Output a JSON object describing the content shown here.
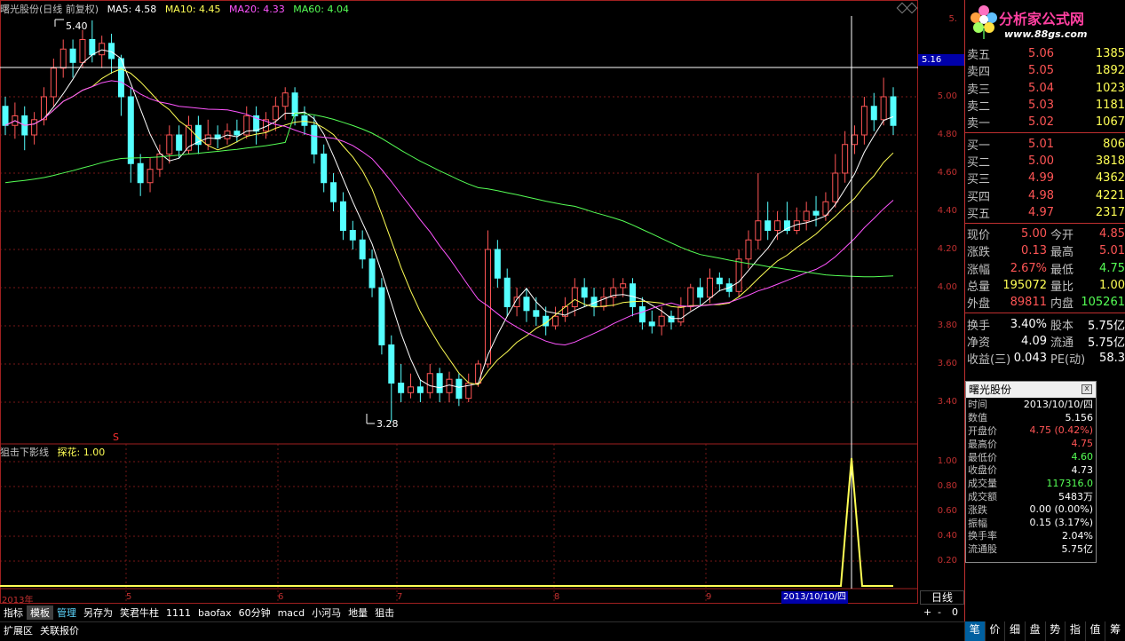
{
  "title": {
    "stock": "曙光股份(日线 前复权)",
    "ma5": "MA5: 4.58",
    "ma10": "MA10: 4.45",
    "ma20": "MA20: 4.33",
    "ma60": "MA60: 4.04"
  },
  "sub_indicator": {
    "name": "狙击下影线",
    "value": "探花: 1.00"
  },
  "price_axis": [
    "5.",
    "5.00",
    "4.80",
    "4.60",
    "4.40",
    "4.20",
    "4.00",
    "3.80",
    "3.60",
    "3.40"
  ],
  "cursor_price": "5.16",
  "sub_axis": [
    "1.00",
    "0.80",
    "0.60",
    "0.40",
    "0.20"
  ],
  "annotations": {
    "high": "5.40",
    "low": "3.28",
    "marker": "S"
  },
  "x_axis": [
    "2013年",
    "5",
    "6",
    "7",
    "8",
    "9"
  ],
  "x_cursor": "2013/10/10/四",
  "period": "日线",
  "zoom": {
    "plus": "+",
    "minus": "-",
    "zero": "0"
  },
  "toolbar1": [
    "指标",
    "模板",
    "管理",
    "另存为",
    "笑君牛柱",
    "1111",
    "baofax",
    "60分钟",
    "macd",
    "小河马",
    "地量",
    "狙击"
  ],
  "toolbar2": [
    "扩展区",
    "关联报价"
  ],
  "logo": {
    "text": "分析家公式网",
    "url": "www.88gs.com"
  },
  "order_book": {
    "asks": [
      {
        "label": "卖五",
        "price": "5.06",
        "vol": "1385"
      },
      {
        "label": "卖四",
        "price": "5.05",
        "vol": "1892"
      },
      {
        "label": "卖三",
        "price": "5.04",
        "vol": "1023"
      },
      {
        "label": "卖二",
        "price": "5.03",
        "vol": "1181"
      },
      {
        "label": "卖一",
        "price": "5.02",
        "vol": "1067"
      }
    ],
    "bids": [
      {
        "label": "买一",
        "price": "5.01",
        "vol": "806"
      },
      {
        "label": "买二",
        "price": "5.00",
        "vol": "3818"
      },
      {
        "label": "买三",
        "price": "4.99",
        "vol": "4362"
      },
      {
        "label": "买四",
        "price": "4.98",
        "vol": "4221"
      },
      {
        "label": "买五",
        "price": "4.97",
        "vol": "2317"
      }
    ]
  },
  "stats": [
    {
      "l1": "现价",
      "v1": "5.00",
      "c1": "up",
      "l2": "今开",
      "v2": "4.85",
      "c2": "up"
    },
    {
      "l1": "涨跌",
      "v1": "0.13",
      "c1": "up",
      "l2": "最高",
      "v2": "5.01",
      "c2": "up"
    },
    {
      "l1": "涨幅",
      "v1": "2.67%",
      "c1": "up",
      "l2": "最低",
      "v2": "4.75",
      "c2": "down"
    },
    {
      "l1": "总量",
      "v1": "195072",
      "c1": "yellow",
      "l2": "量比",
      "v2": "1.00",
      "c2": "yellow"
    },
    {
      "l1": "外盘",
      "v1": "89811",
      "c1": "up",
      "l2": "内盘",
      "v2": "105261",
      "c2": "down"
    }
  ],
  "stats2": [
    {
      "l1": "换手",
      "v1": "3.40%",
      "c1": "white",
      "l2": "股本",
      "v2": "5.75亿",
      "c2": "white"
    },
    {
      "l1": "净资",
      "v1": "4.09",
      "c1": "white",
      "l2": "流通",
      "v2": "5.75亿",
      "c2": "white"
    },
    {
      "l1": "收益(三)",
      "v1": "0.043",
      "c1": "white",
      "l2": "PE(动)",
      "v2": "58.3",
      "c2": "white"
    }
  ],
  "bottom_tabs": [
    "笔",
    "价",
    "细",
    "盘",
    "势",
    "指",
    "值",
    "筹"
  ],
  "info_popup": {
    "title": "曙光股份",
    "close": "x",
    "rows": [
      {
        "k": "时间",
        "v": "2013/10/10/四",
        "c": "white"
      },
      {
        "k": "数值",
        "v": "5.156",
        "c": "white"
      },
      {
        "k": "开盘价",
        "v": "4.75 (0.42%)",
        "c": "up"
      },
      {
        "k": "最高价",
        "v": "4.75",
        "c": "up"
      },
      {
        "k": "最低价",
        "v": "4.60",
        "c": "down"
      },
      {
        "k": "收盘价",
        "v": "4.73",
        "c": "white"
      },
      {
        "k": "成交量",
        "v": "117316.0",
        "c": "down"
      },
      {
        "k": "成交额",
        "v": "5483万",
        "c": "white"
      },
      {
        "k": "涨跌",
        "v": "0.00 (0.00%)",
        "c": "white"
      },
      {
        "k": "振幅",
        "v": "0.15 (3.17%)",
        "c": "white"
      },
      {
        "k": "换手率",
        "v": "2.04%",
        "c": "white"
      },
      {
        "k": "流通股",
        "v": "5.75亿",
        "c": "white"
      }
    ]
  },
  "colors": {
    "up": "#ff5555",
    "down": "#55ffff",
    "ma5": "#ffffff",
    "ma10": "#ffff55",
    "ma20": "#ff55ff",
    "ma60": "#55ff55",
    "grid": "#a02020",
    "signal": "#ffff55"
  },
  "chart_data": {
    "type": "candlestick",
    "ylim": [
      3.3,
      5.2
    ],
    "candles": [
      [
        4.95,
        4.85,
        5.0,
        4.8
      ],
      [
        4.85,
        4.9,
        4.97,
        4.78
      ],
      [
        4.9,
        4.8,
        4.95,
        4.72
      ],
      [
        4.8,
        4.88,
        4.92,
        4.75
      ],
      [
        4.88,
        5.0,
        5.05,
        4.85
      ],
      [
        5.0,
        5.15,
        5.2,
        4.95
      ],
      [
        5.15,
        5.25,
        5.3,
        5.1
      ],
      [
        5.25,
        5.18,
        5.3,
        5.1
      ],
      [
        5.18,
        5.3,
        5.35,
        5.15
      ],
      [
        5.3,
        5.22,
        5.4,
        5.18
      ],
      [
        5.22,
        5.28,
        5.32,
        5.15
      ],
      [
        5.28,
        5.2,
        5.33,
        5.12
      ],
      [
        5.2,
        5.0,
        5.22,
        4.9
      ],
      [
        5.0,
        4.65,
        5.05,
        4.55
      ],
      [
        4.65,
        4.55,
        4.7,
        4.48
      ],
      [
        4.55,
        4.62,
        4.68,
        4.5
      ],
      [
        4.62,
        4.7,
        4.75,
        4.58
      ],
      [
        4.7,
        4.8,
        4.85,
        4.65
      ],
      [
        4.8,
        4.72,
        4.85,
        4.68
      ],
      [
        4.72,
        4.85,
        4.9,
        4.7
      ],
      [
        4.85,
        4.75,
        4.9,
        4.7
      ],
      [
        4.75,
        4.8,
        4.88,
        4.72
      ],
      [
        4.8,
        4.78,
        4.85,
        4.73
      ],
      [
        4.78,
        4.82,
        4.86,
        4.75
      ],
      [
        4.82,
        4.8,
        4.88,
        4.76
      ],
      [
        4.8,
        4.9,
        4.95,
        4.78
      ],
      [
        4.9,
        4.82,
        4.95,
        4.75
      ],
      [
        4.82,
        4.88,
        4.92,
        4.78
      ],
      [
        4.88,
        4.95,
        5.0,
        4.82
      ],
      [
        4.95,
        5.02,
        5.05,
        4.88
      ],
      [
        5.02,
        4.9,
        5.05,
        4.85
      ],
      [
        4.9,
        4.85,
        4.95,
        4.8
      ],
      [
        4.85,
        4.7,
        4.9,
        4.65
      ],
      [
        4.7,
        4.55,
        4.75,
        4.5
      ],
      [
        4.55,
        4.45,
        4.6,
        4.4
      ],
      [
        4.45,
        4.3,
        4.5,
        4.25
      ],
      [
        4.3,
        4.25,
        4.35,
        4.2
      ],
      [
        4.25,
        4.15,
        4.3,
        4.1
      ],
      [
        4.15,
        4.0,
        4.2,
        3.95
      ],
      [
        4.0,
        3.7,
        4.05,
        3.65
      ],
      [
        3.7,
        3.5,
        3.75,
        3.3
      ],
      [
        3.5,
        3.45,
        3.6,
        3.4
      ],
      [
        3.45,
        3.48,
        3.55,
        3.42
      ],
      [
        3.48,
        3.45,
        3.52,
        3.4
      ],
      [
        3.45,
        3.55,
        3.6,
        3.42
      ],
      [
        3.55,
        3.45,
        3.58,
        3.4
      ],
      [
        3.45,
        3.52,
        3.56,
        3.4
      ],
      [
        3.52,
        3.42,
        3.55,
        3.38
      ],
      [
        3.42,
        3.5,
        3.55,
        3.4
      ],
      [
        3.5,
        3.6,
        3.62,
        3.48
      ],
      [
        3.6,
        4.2,
        4.3,
        3.58
      ],
      [
        4.2,
        4.05,
        4.25,
        4.0
      ],
      [
        4.05,
        3.9,
        4.1,
        3.85
      ],
      [
        3.9,
        3.95,
        4.0,
        3.85
      ],
      [
        3.95,
        3.88,
        4.0,
        3.82
      ],
      [
        3.88,
        3.85,
        3.95,
        3.8
      ],
      [
        3.85,
        3.8,
        3.9,
        3.75
      ],
      [
        3.8,
        3.85,
        3.9,
        3.78
      ],
      [
        3.85,
        3.9,
        3.95,
        3.82
      ],
      [
        3.9,
        4.0,
        4.05,
        3.85
      ],
      [
        4.0,
        3.95,
        4.05,
        3.9
      ],
      [
        3.95,
        3.9,
        4.0,
        3.85
      ],
      [
        3.9,
        3.95,
        4.0,
        3.88
      ],
      [
        3.95,
        4.0,
        4.05,
        3.9
      ],
      [
        4.0,
        4.02,
        4.05,
        3.95
      ],
      [
        4.02,
        3.9,
        4.05,
        3.85
      ],
      [
        3.9,
        3.82,
        3.95,
        3.78
      ],
      [
        3.82,
        3.8,
        3.88,
        3.76
      ],
      [
        3.8,
        3.85,
        3.9,
        3.75
      ],
      [
        3.85,
        3.82,
        3.88,
        3.78
      ],
      [
        3.82,
        3.9,
        3.95,
        3.8
      ],
      [
        3.9,
        4.0,
        4.02,
        3.88
      ],
      [
        4.0,
        3.95,
        4.05,
        3.9
      ],
      [
        3.95,
        4.05,
        4.1,
        3.92
      ],
      [
        4.05,
        4.02,
        4.08,
        3.98
      ],
      [
        4.02,
        3.98,
        4.05,
        3.95
      ],
      [
        3.98,
        4.15,
        4.2,
        3.95
      ],
      [
        4.15,
        4.25,
        4.3,
        4.1
      ],
      [
        4.25,
        4.35,
        4.6,
        4.2
      ],
      [
        4.35,
        4.3,
        4.45,
        4.25
      ],
      [
        4.3,
        4.35,
        4.4,
        4.25
      ],
      [
        4.35,
        4.3,
        4.45,
        4.28
      ],
      [
        4.3,
        4.35,
        4.42,
        4.28
      ],
      [
        4.35,
        4.4,
        4.45,
        4.3
      ],
      [
        4.4,
        4.38,
        4.48,
        4.32
      ],
      [
        4.38,
        4.45,
        4.5,
        4.35
      ],
      [
        4.45,
        4.6,
        4.7,
        4.42
      ],
      [
        4.6,
        4.75,
        4.82,
        4.55
      ],
      [
        4.75,
        4.8,
        4.85,
        4.7
      ],
      [
        4.8,
        4.95,
        5.0,
        4.75
      ],
      [
        4.95,
        4.88,
        5.02,
        4.82
      ],
      [
        4.88,
        5.0,
        5.1,
        4.85
      ],
      [
        5.0,
        4.85,
        5.05,
        4.8
      ]
    ],
    "signal": 1.0,
    "signal_date": "2013/10/10"
  }
}
